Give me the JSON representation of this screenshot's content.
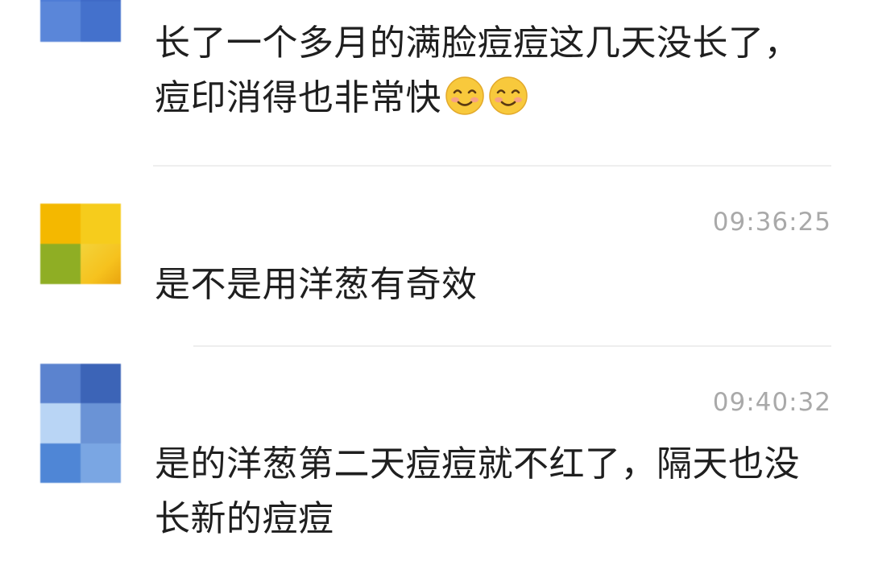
{
  "comments": [
    {
      "text": "长了一个多月的满脸痘痘这几天没长了，痘印消得也非常快",
      "time": "",
      "emoji_count": 2
    },
    {
      "text": "是不是用洋葱有奇效",
      "time": "09:36:25"
    },
    {
      "text": "是的洋葱第二天痘痘就不红了，隔天也没长新的痘痘",
      "time": "09:40:32"
    }
  ],
  "emoji": {
    "name": "smiling-face-icon",
    "face_color": "#f8c93c",
    "blush_color": "#f79a8f"
  },
  "colors": {
    "text": "#1f1f1f",
    "time": "#a9a9a9",
    "divider": "#eeeeee"
  }
}
